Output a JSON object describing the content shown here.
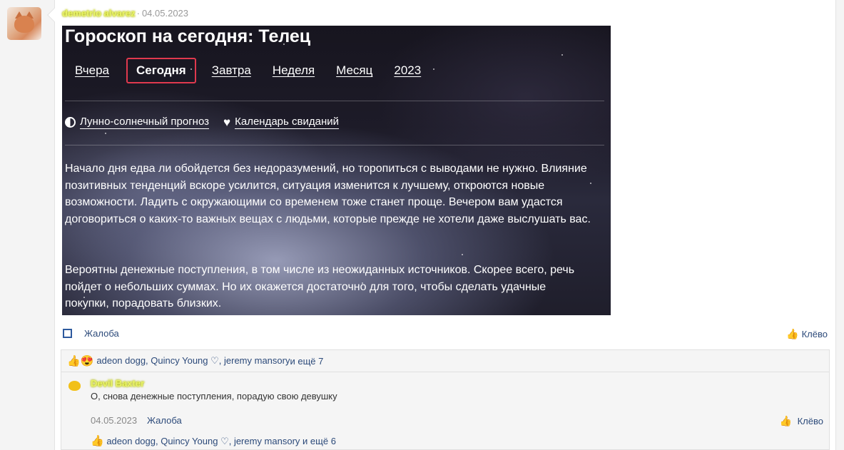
{
  "post": {
    "author": "demetrio alvarez",
    "separator": "·",
    "date": "04.05.2023"
  },
  "horoscope": {
    "title": "Гороскоп на сегодня: Телец",
    "tabs": [
      {
        "label": "Вчера",
        "active": false
      },
      {
        "label": "Сегодня",
        "active": true
      },
      {
        "label": "Завтра",
        "active": false
      },
      {
        "label": "Неделя",
        "active": false
      },
      {
        "label": "Месяц",
        "active": false
      },
      {
        "label": "2023",
        "active": false
      }
    ],
    "links": {
      "lunar": "Лунно-солнечный прогноз",
      "dating": "Календарь свиданий"
    },
    "paragraph1": "Начало дня едва ли обойдется без недоразумений, но торопиться с выводами не нужно. Влияние позитивных тенденций вскоре усилится, ситуация изменится к лучшему, откроются новые возможности. Ладить с окружающими со временем тоже станет проще. Вечером вам удастся договориться о каких-то важных вещах с людьми, которые прежде не хотели даже выслушать вас.",
    "paragraph2": "Вероятны денежные поступления, в том числе из неожиданных источников. Скорее всего, речь пойдет о небольших суммах. Но их окажется достаточно для того, чтобы сделать удачные покупки, порадовать близких."
  },
  "actions": {
    "complaint": "Жалоба",
    "like": "Клёво"
  },
  "reactions": {
    "names": "adeon dogg, Quincy Young ♡, jeremy mansory",
    "more": " и ещё 7"
  },
  "comment": {
    "author": "Devil Baxter",
    "text": "О, снова денежные поступления, порадую свою девушку",
    "date": "04.05.2023",
    "complaint": "Жалоба",
    "like": "Клёво",
    "reactions_names": "adeon dogg, Quincy Young ♡, jeremy mansory",
    "reactions_more": " и ещё 6"
  },
  "colors": {
    "accent_red": "#e0394e",
    "link_blue": "#2c4a7a",
    "author_highlight": "#e8f36a"
  }
}
